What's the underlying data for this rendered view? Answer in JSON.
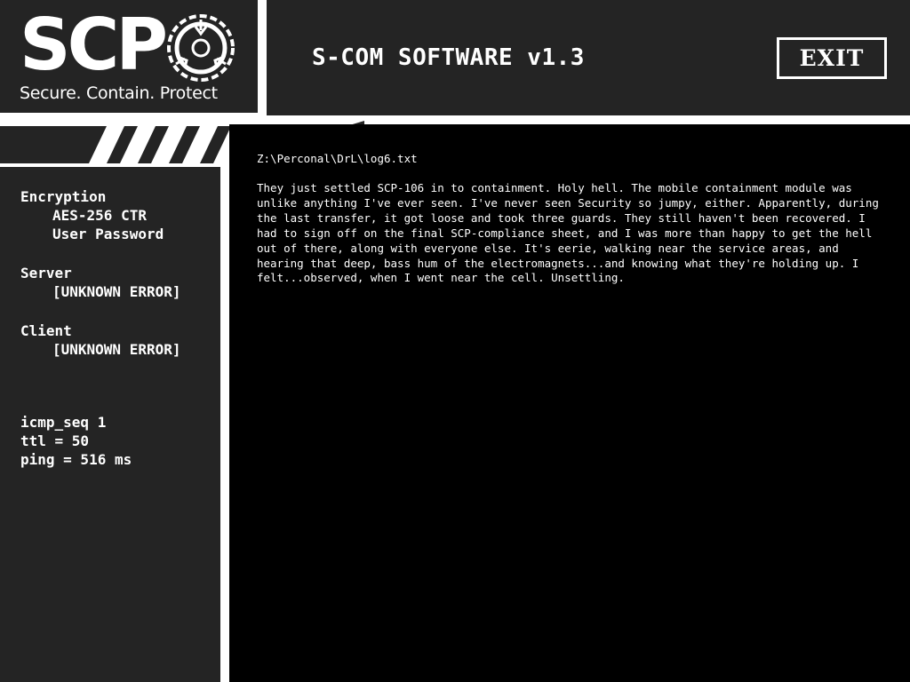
{
  "logo": {
    "text": "SCP",
    "tagline": "Secure. Contain. Protect",
    "emblem": "scp-foundation-emblem-icon"
  },
  "header": {
    "title": "S-COM SOFTWARE v1.3",
    "exit_label": "EXIT"
  },
  "sidebar": {
    "encryption": {
      "heading": "Encryption",
      "cipher": "AES-256 CTR",
      "method": "User Password"
    },
    "server": {
      "heading": "Server",
      "status": "[UNKNOWN ERROR]"
    },
    "client": {
      "heading": "Client",
      "status": "[UNKNOWN ERROR]"
    },
    "stats": {
      "icmp_seq": "icmp_seq 1",
      "ttl": "ttl = 50",
      "ping": "ping = 516 ms"
    }
  },
  "document": {
    "path": "Z:\\Perconal\\DrL\\log6.txt",
    "body": "They just settled SCP-106 in to containment. Holy hell. The mobile containment module was unlike anything I've ever seen. I've never seen Security so jumpy, either. Apparently, during the last transfer, it got loose and took three guards. They still haven't been recovered. I had to sign off on the final SCP-compliance sheet, and I was more than happy to get the hell out of there, along with everyone else. It's eerie, walking near the service areas, and hearing that deep, bass hum of the electromagnets...and knowing what they're holding up. I felt...observed, when I went near the cell. Unsettling."
  },
  "colors": {
    "panel": "#242424",
    "terminal": "#000000",
    "text": "#ffffff",
    "frame": "#ffffff"
  }
}
